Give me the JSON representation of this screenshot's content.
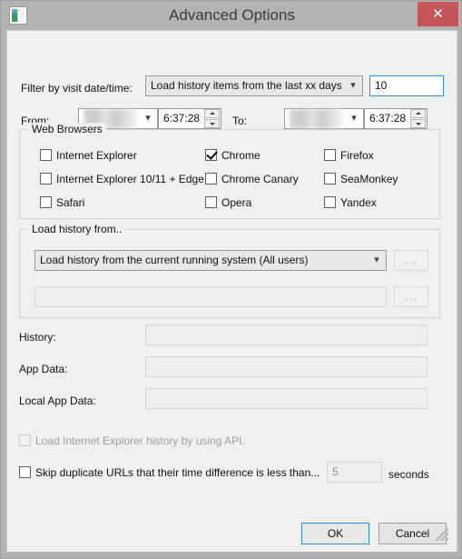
{
  "window": {
    "title": "Advanced Options",
    "app_icon": "application-icon",
    "close_label": "✕"
  },
  "filter": {
    "label": "Filter by visit date/time:",
    "mode_selected": "Load history items from the last xx days",
    "days_value": "10",
    "from_label": "From:",
    "from_date": "",
    "from_time": "6:37:28",
    "to_label": "To:",
    "to_date": "",
    "to_time": "6:37:28"
  },
  "web_browsers": {
    "title": "Web Browsers",
    "items": [
      {
        "label": "Internet Explorer",
        "checked": false
      },
      {
        "label": "Internet Explorer 10/11 + Edge",
        "checked": false
      },
      {
        "label": "Safari",
        "checked": false
      },
      {
        "label": "Chrome",
        "checked": true
      },
      {
        "label": "Chrome Canary",
        "checked": false
      },
      {
        "label": "Opera",
        "checked": false
      },
      {
        "label": "Firefox",
        "checked": false
      },
      {
        "label": "SeaMonkey",
        "checked": false
      },
      {
        "label": "Yandex",
        "checked": false
      }
    ]
  },
  "load_history_from": {
    "title": "Load history from..",
    "source_selected": "Load history from the current running system (All users)",
    "browse_label": "...",
    "path_value": "",
    "path_browse_label": "..."
  },
  "paths": {
    "history_label": "History:",
    "history_value": "",
    "app_data_label": "App Data:",
    "app_data_value": "",
    "local_app_data_label": "Local App Data:",
    "local_app_data_value": ""
  },
  "options": {
    "ie_api_label": "Load Internet Explorer history by using API.",
    "ie_api_checked": false,
    "skip_dup_label": "Skip duplicate URLs that their time difference is less than...",
    "skip_dup_checked": false,
    "seconds_value": "5",
    "seconds_label": "seconds"
  },
  "buttons": {
    "ok": "OK",
    "cancel": "Cancel"
  },
  "colors": {
    "titlebar": "#b3b3b3",
    "client": "#f0f0f0",
    "close": "#c4555a",
    "focus": "#2a8fe0"
  }
}
